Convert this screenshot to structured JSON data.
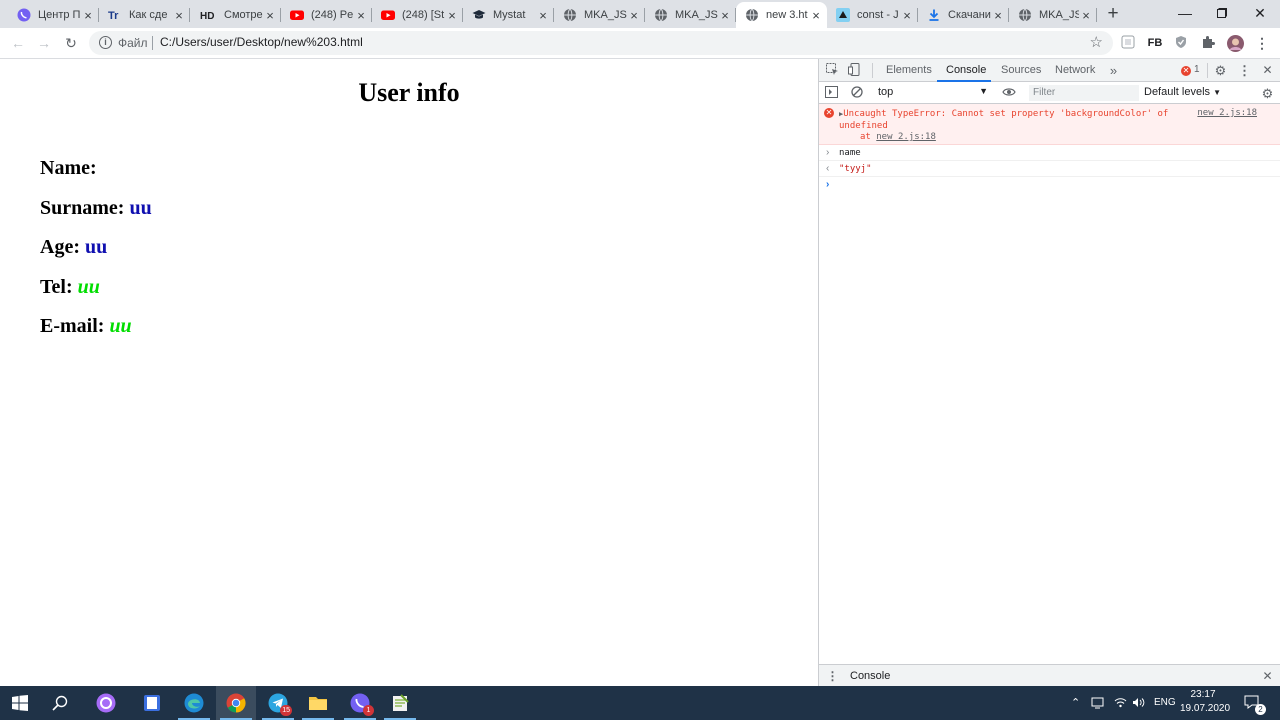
{
  "browser": {
    "tabs": [
      {
        "title": "Центр П",
        "icon": "viber-icon"
      },
      {
        "title": "Как сде",
        "icon": "tr-icon"
      },
      {
        "title": "Смотре",
        "icon": "hd-icon"
      },
      {
        "title": "(248) Pe",
        "icon": "youtube-icon"
      },
      {
        "title": "(248) [St",
        "icon": "youtube-icon"
      },
      {
        "title": "Mystat",
        "icon": "graduation-cap-icon"
      },
      {
        "title": "MKA_JS",
        "icon": "globe-icon"
      },
      {
        "title": "MKA_JS",
        "icon": "globe-icon"
      },
      {
        "title": "new 3.ht",
        "icon": "globe-icon",
        "active": true
      },
      {
        "title": "const - J",
        "icon": "mdn-icon"
      },
      {
        "title": "Скачани",
        "icon": "download-icon"
      },
      {
        "title": "MKA_JS",
        "icon": "globe-icon"
      }
    ],
    "hd_label": "HD",
    "tr_label": "Tr",
    "omnibox": {
      "protocol_label": "Файл",
      "url": "C:/Users/user/Desktop/new%203.html"
    },
    "extensions": {
      "fb_label": "FB"
    }
  },
  "page": {
    "title": "User info",
    "fields": [
      {
        "label": "Name:",
        "value": "",
        "style": "blue"
      },
      {
        "label": "Surname:",
        "value": "uu",
        "style": "blue"
      },
      {
        "label": "Age:",
        "value": "uu",
        "style": "blue"
      },
      {
        "label": "Tel:",
        "value": "uu",
        "style": "green"
      },
      {
        "label": "E-mail:",
        "value": "uu",
        "style": "green"
      }
    ]
  },
  "devtools": {
    "tabs": [
      "Elements",
      "Console",
      "Sources",
      "Network"
    ],
    "active_tab": "Console",
    "error_count": "1",
    "context": "top",
    "filter_placeholder": "Filter",
    "levels": "Default levels",
    "error": {
      "message": "Uncaught TypeError: Cannot set property 'backgroundColor' of undefined",
      "source": "new 2.js:18",
      "at_prefix": "at",
      "at_link": "new 2.js:18"
    },
    "lines": [
      {
        "prefix": "›",
        "text": "name",
        "color": "#202124"
      },
      {
        "prefix": "‹",
        "text": "\"tyyj\"",
        "color": "#c41a16"
      }
    ],
    "drawer_label": "Console"
  },
  "taskbar": {
    "apps": [
      {
        "name": "start-button",
        "icon": "windows-icon"
      },
      {
        "name": "search-button",
        "icon": "search-icon"
      },
      {
        "name": "cortana-app",
        "icon": "cortana-icon"
      },
      {
        "name": "notes-app",
        "icon": "notes-icon"
      },
      {
        "name": "edge-app",
        "icon": "edge-icon"
      },
      {
        "name": "chrome-app",
        "icon": "chrome-icon",
        "active": true
      },
      {
        "name": "telegram-app",
        "icon": "telegram-icon",
        "badge": "15"
      },
      {
        "name": "explorer-app",
        "icon": "folder-icon"
      },
      {
        "name": "viber-app",
        "icon": "viber-icon",
        "badge": "1"
      },
      {
        "name": "notepadpp-app",
        "icon": "notepad-plus-icon"
      }
    ],
    "language": "ENG",
    "time": "23:17",
    "date": "19.07.2020",
    "notification_count": "2"
  },
  "colors": {
    "blue_value": "#1010b0",
    "green_value": "#00dd00",
    "error_red": "#e8432e",
    "devtools_accent": "#1a73e8"
  }
}
